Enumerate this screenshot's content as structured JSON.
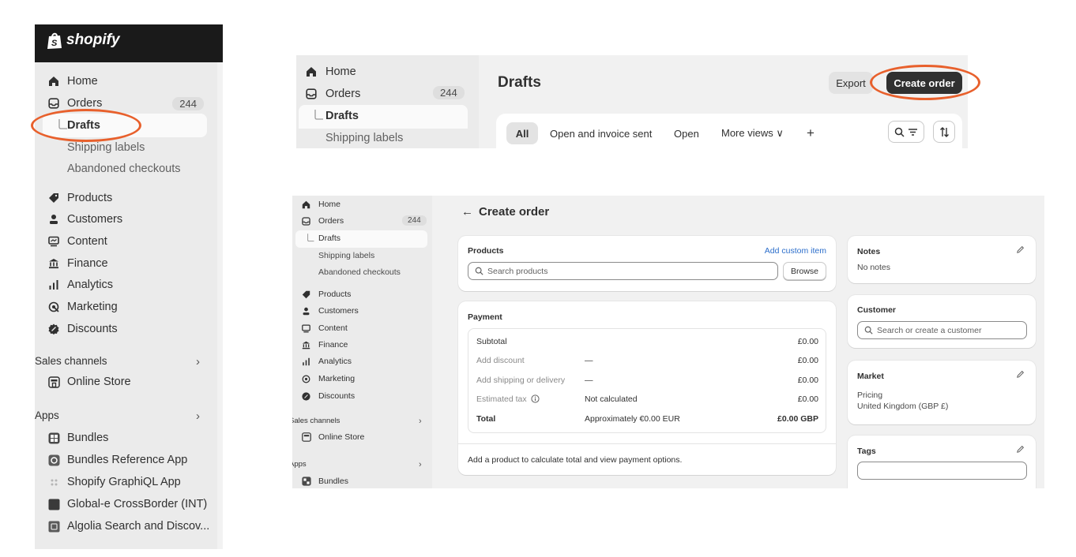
{
  "brand": {
    "name": "shopify"
  },
  "sidebar": {
    "home": "Home",
    "orders": "Orders",
    "orders_count": "244",
    "drafts": "Drafts",
    "shipping_labels": "Shipping labels",
    "abandoned_checkouts": "Abandoned checkouts",
    "products": "Products",
    "customers": "Customers",
    "content": "Content",
    "finance": "Finance",
    "analytics": "Analytics",
    "marketing": "Marketing",
    "discounts": "Discounts",
    "sales_channels": "Sales channels",
    "online_store": "Online Store",
    "apps": "Apps",
    "app_items": [
      "Bundles",
      "Bundles Reference App",
      "Shopify GraphiQL App",
      "Global-e CrossBorder (INT)",
      "Algolia Search and Discov..."
    ],
    "sales_channels_clipped": "Sales channels",
    "apps_clipped": "Apps"
  },
  "drafts_page": {
    "title": "Drafts",
    "export": "Export",
    "create_order": "Create order",
    "tabs": [
      "All",
      "Open and invoice sent",
      "Open",
      "More views ∨"
    ],
    "add_view": "+"
  },
  "create_order": {
    "back_arrow": "←",
    "title": "Create order",
    "products": {
      "title": "Products",
      "add_custom_item": "Add custom item",
      "search_placeholder": "Search products",
      "browse": "Browse"
    },
    "payment": {
      "title": "Payment",
      "rows": [
        {
          "label": "Subtotal",
          "detail": "",
          "amount": "£0.00"
        },
        {
          "label": "Add discount",
          "detail": "—",
          "amount": "£0.00"
        },
        {
          "label": "Add shipping or delivery",
          "detail": "—",
          "amount": "£0.00"
        },
        {
          "label": "Estimated tax",
          "detail": "Not calculated",
          "amount": "£0.00"
        },
        {
          "label": "Total",
          "detail": "Approximately €0.00 EUR",
          "amount": "£0.00 GBP"
        }
      ],
      "footer": "Add a product to calculate total and view payment options."
    },
    "notes": {
      "title": "Notes",
      "value": "No notes"
    },
    "customer": {
      "title": "Customer",
      "placeholder": "Search or create a customer"
    },
    "market": {
      "title": "Market",
      "pricing_label": "Pricing",
      "pricing_value": "United Kingdom (GBP £)"
    },
    "tags": {
      "title": "Tags"
    }
  },
  "colors": {
    "highlight": "#e8602c",
    "topbar": "#1a1a1a",
    "primary_button": "#303030",
    "link": "#2c6ecb"
  }
}
